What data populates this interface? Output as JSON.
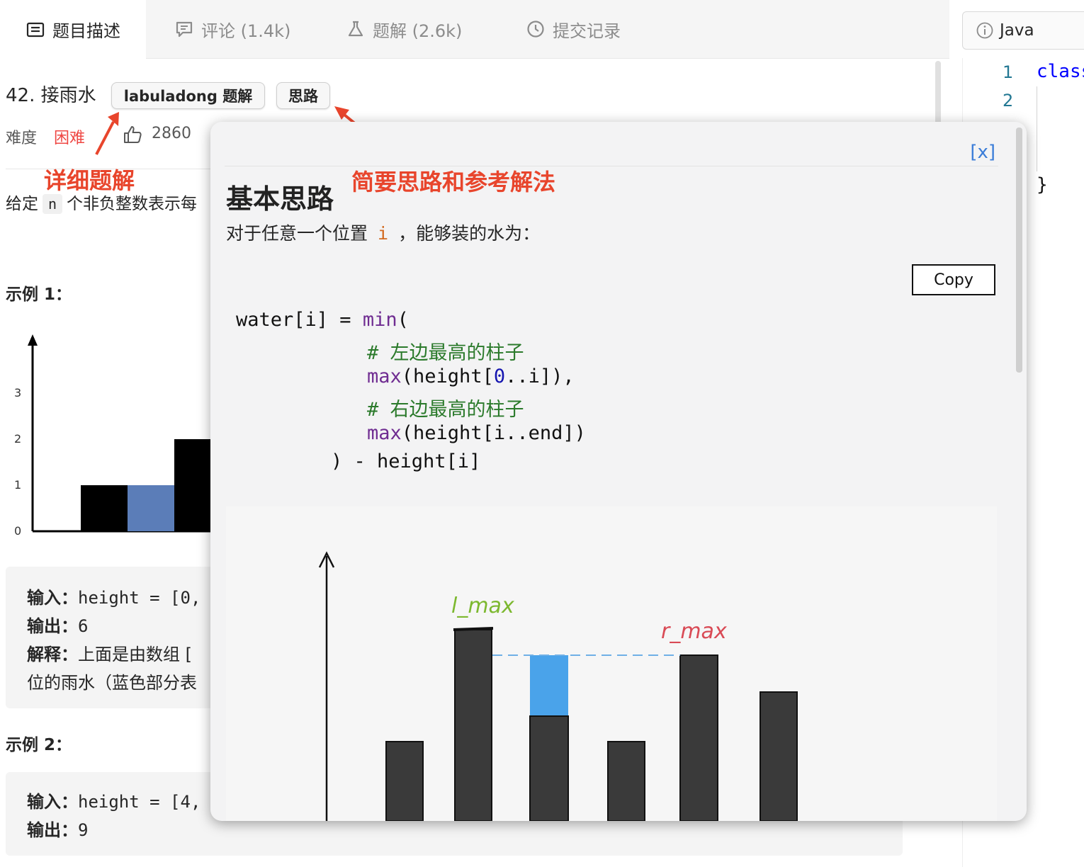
{
  "tabs": [
    {
      "label": "题目描述",
      "icon": "description-icon",
      "active": true
    },
    {
      "label": "评论 (1.4k)",
      "icon": "comment-icon",
      "active": false
    },
    {
      "label": "题解 (2.6k)",
      "icon": "flask-icon",
      "active": false
    },
    {
      "label": "提交记录",
      "icon": "clock-icon",
      "active": false
    }
  ],
  "language": {
    "value": "Java",
    "icon": "info-icon"
  },
  "editor": {
    "lines": [
      {
        "num": "1",
        "code": "class"
      },
      {
        "num": "2",
        "code": ""
      }
    ],
    "closing_brace": "}"
  },
  "problem": {
    "title": "42. 接雨水",
    "tag_solution": "labuladong 题解",
    "tag_idea": "思路",
    "difficulty_label": "难度",
    "difficulty_value": "困难",
    "likes": "2860",
    "desc_prefix": "给定",
    "desc_code": "n",
    "desc_rest": "个非负整数表示每",
    "example1_title": "示例 1：",
    "example2_title": "示例 2：",
    "example1": {
      "input_label": "输入：",
      "input_value": "height = [0,",
      "output_label": "输出：",
      "output_value": "6",
      "explain_label": "解释：",
      "explain_value": "上面是由数组 [",
      "explain_cont": "位的雨水（蓝色部分表"
    },
    "example2": {
      "input_label": "输入：",
      "input_value": "height = [4,",
      "output_label": "输出：",
      "output_value": "9"
    }
  },
  "figure1": {
    "y_ticks": [
      "0",
      "1",
      "2",
      "3"
    ],
    "bars": [
      {
        "value": 1,
        "color": "#000000"
      },
      {
        "value": 1,
        "color": "#5b7db8"
      },
      {
        "value": 2,
        "color": "#000000"
      }
    ]
  },
  "annotations": {
    "left": "详细题解",
    "right": "简要思路和参考解法",
    "color": "#e8452c"
  },
  "popup": {
    "close": "[x]",
    "heading": "基本思路",
    "text_before": "对于任意一个位置",
    "text_code": "i",
    "text_after": "，能够装的水为：",
    "copy_label": "Copy",
    "code": {
      "l1_a": "water[i] = ",
      "l1_kw": "min",
      "l1_b": "(",
      "l2": "# 左边最高的柱子",
      "l3_kw": "max",
      "l3_a": "(height[",
      "l3_num": "0",
      "l3_b": "..i]),",
      "l4": "# 右边最高的柱子",
      "l5_kw": "max",
      "l5_a": "(height[i..end])",
      "l6": ") - height[i]"
    },
    "figure": {
      "l_max_label": "l_max",
      "r_max_label": "r_max",
      "l_color": "#7cb82f",
      "r_color": "#d94a55",
      "water_color": "#4aa3ea",
      "bar_color": "#3a3a3a"
    }
  }
}
